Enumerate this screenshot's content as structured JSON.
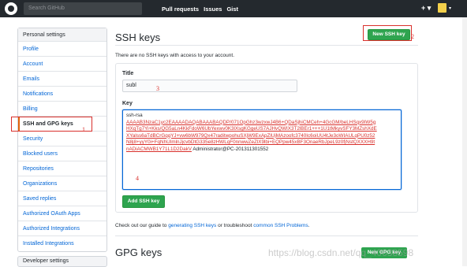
{
  "topbar": {
    "search_placeholder": "Search GitHub",
    "nav": [
      "Pull requests",
      "Issues",
      "Gist"
    ],
    "plus_label": "+ ▾"
  },
  "sidebar": {
    "header": "Personal settings",
    "items": [
      {
        "label": "Profile"
      },
      {
        "label": "Account"
      },
      {
        "label": "Emails"
      },
      {
        "label": "Notifications"
      },
      {
        "label": "Billing"
      },
      {
        "label": "SSH and GPG keys",
        "active": true
      },
      {
        "label": "Security"
      },
      {
        "label": "Blocked users"
      },
      {
        "label": "Repositories"
      },
      {
        "label": "Organizations"
      },
      {
        "label": "Saved replies"
      },
      {
        "label": "Authorized OAuth Apps"
      },
      {
        "label": "Authorized Integrations"
      },
      {
        "label": "Installed Integrations"
      }
    ],
    "next_header": "Developer settings"
  },
  "main": {
    "ssh_title": "SSH keys",
    "new_ssh_button": "New SSH key",
    "no_keys_text": "There are no SSH keys with access to your account.",
    "title_label": "Title",
    "title_value": "subl",
    "key_label": "Key",
    "key_value_lines": [
      "ssh-rsa",
      "AAAAB3NzaC1yc2EAAAADAQABAAABAQDP/071OpGhz3wzxwJ4B6+QDaSjhiCMCeh+4GcGM/beLHSqx9IW5g",
      "HXqTg7Yi+Kks/QG5aLn4KkFdoW6UbYexwv0K3lXsgKGgeUS7AJHvQWIX3T2lBEr1+++1U1tMkyvSFY3MZshXdE",
      "XYalss6aTdBCrGqqYJ+vw6bW979Qx47raditwpohuSXjW9ExApZlUjMAzoofc3740Ic6oiUU4tJe3oWIAULqPU0z52",
      "N8j8+yyY0i+FqNhUImlnJjcvbDtG335e8zHWLqF0nnwwZeZlX9lbi+EQPpw45xBF3OnaeRbJpeL9z0fjNstQXXXH9t",
      "nADiACMWB1Y71L1D2DakV",
      "Administrator@PC-201311301552"
    ],
    "add_ssh_button": "Add SSH key",
    "guide_prefix": "Check out our guide to ",
    "guide_link1": "generating SSH keys",
    "guide_mid": " or troubleshoot ",
    "guide_link2": "common SSH Problems",
    "guide_suffix": ".",
    "gpg_title": "GPG keys",
    "new_gpg_button": "New GPG key"
  },
  "annotations": [
    "1",
    "2",
    "3",
    "4"
  ],
  "watermark": "https://blog.csdn.net/qq_40638598",
  "colors": {
    "accent_green": "#2ea44f",
    "annotation_red": "#d9302c",
    "link_blue": "#0366d6"
  }
}
